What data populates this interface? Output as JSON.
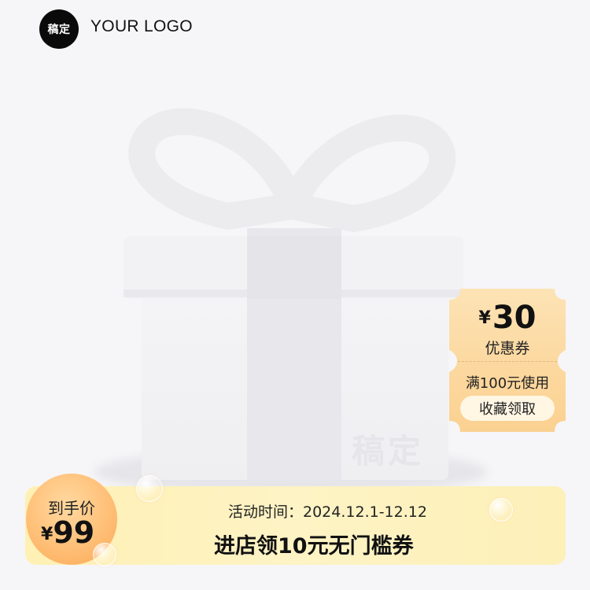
{
  "header": {
    "badge_text": "稿定",
    "logo_text": "YOUR LOGO"
  },
  "product": {
    "icon": "gift-box-icon",
    "watermark": "稿定"
  },
  "coupon": {
    "currency": "¥",
    "amount": "30",
    "title": "优惠券",
    "condition": "满100元使用",
    "button_label": "收藏领取"
  },
  "banner": {
    "price_label": "到手价",
    "currency": "¥",
    "price": "99",
    "activity_time": "活动时间：2024.12.1-12.12",
    "headline": "进店领10元无门槛券"
  },
  "colors": {
    "background": "#f6f6f8",
    "banner": "#fdf3c4",
    "price_circle": "#ffbf77",
    "coupon": "#fbd69c",
    "logo_badge": "#0a0a0a"
  }
}
